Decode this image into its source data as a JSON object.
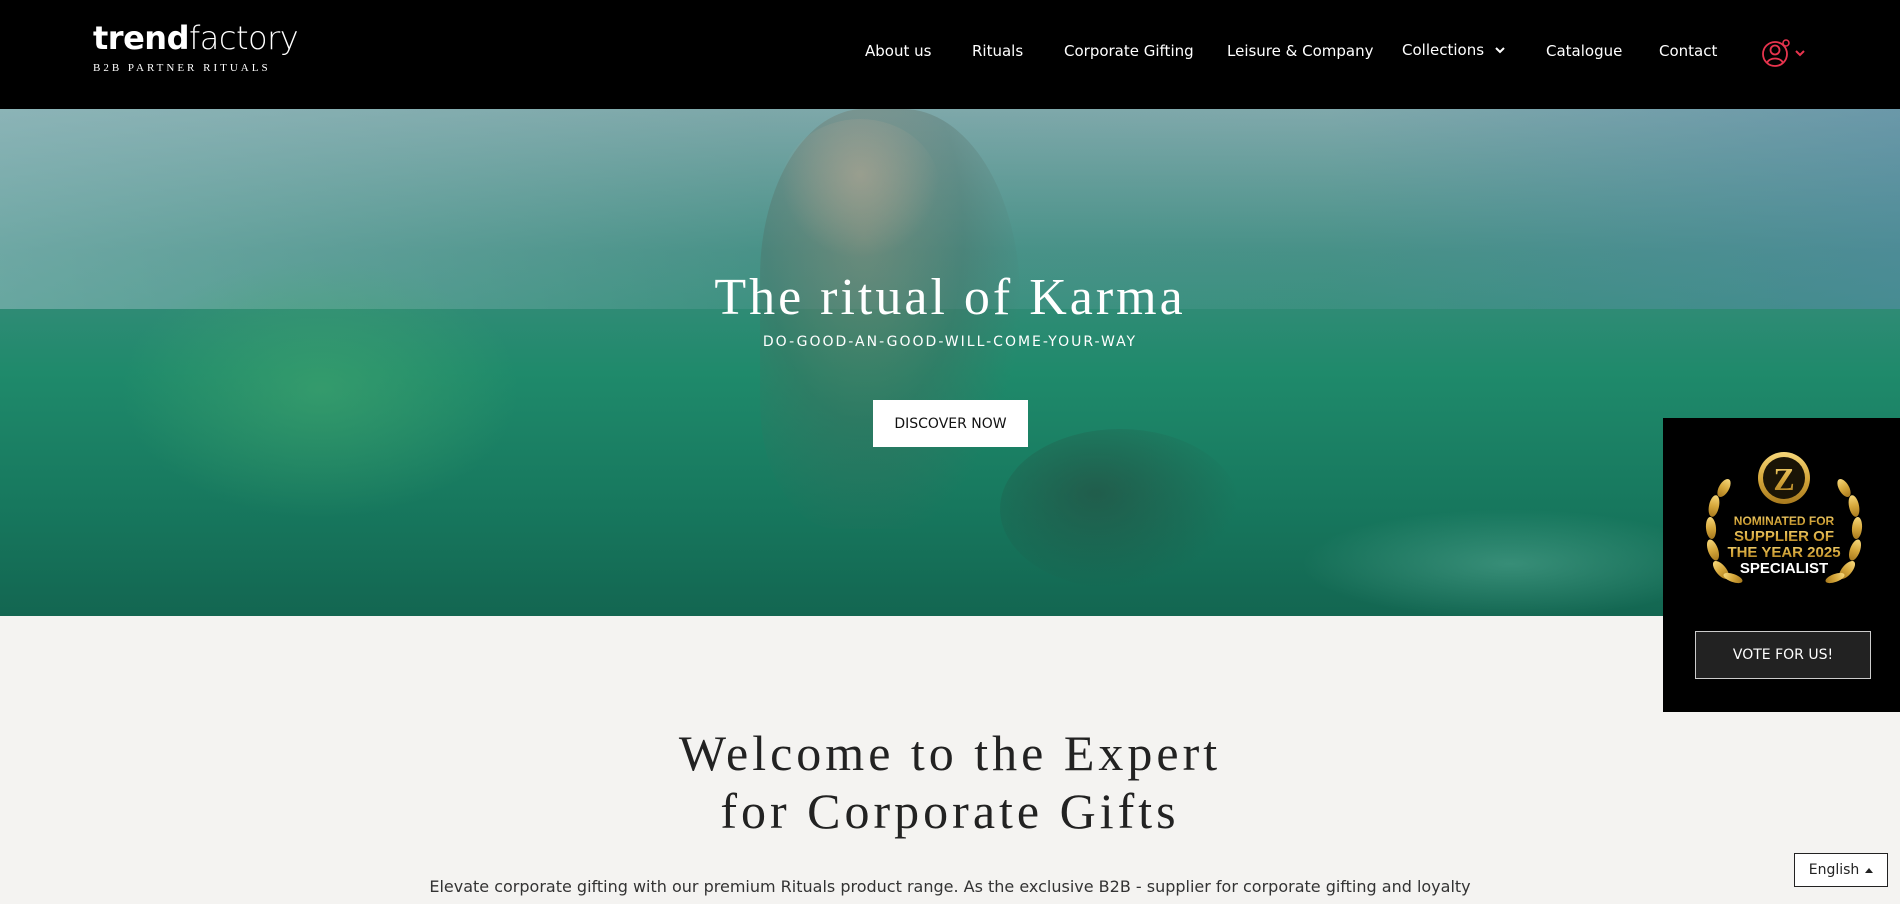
{
  "header": {
    "logo": {
      "brand_bold": "trend",
      "brand_light": "factory",
      "tagline": "B2B PARTNER RITUALS"
    },
    "nav": [
      {
        "label": "About us"
      },
      {
        "label": "Rituals"
      },
      {
        "label": "Corporate Gifting"
      },
      {
        "label": "Leisure & Company"
      },
      {
        "label": "Collections"
      },
      {
        "label": "Catalogue"
      },
      {
        "label": "Contact"
      }
    ],
    "icons": {
      "collections_dropdown": "chevron-down-icon",
      "account": "user-icon"
    },
    "accent_color": "#e8344e"
  },
  "hero": {
    "title": "The ritual of Karma",
    "subtitle": "DO-GOOD-AN-GOOD-WILL-COME-YOUR-WAY",
    "button_label": "DISCOVER NOW"
  },
  "welcome": {
    "title_line1": "Welcome to the Expert",
    "title_line2": "for Corporate Gifts",
    "intro": "Elevate corporate gifting with our premium Rituals product range. As the exclusive B2B - supplier for corporate gifting and loyalty"
  },
  "award": {
    "badge_letter": "Z",
    "line1": "NOMINATED FOR",
    "line2": "SUPPLIER OF",
    "line3": "THE YEAR 2025",
    "line4": "SPECIALIST",
    "button_label": "VOTE FOR US!"
  },
  "language": {
    "selected": "English"
  }
}
